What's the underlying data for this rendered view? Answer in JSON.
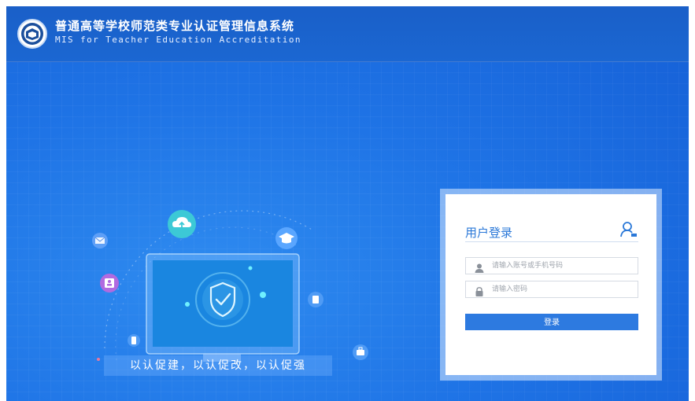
{
  "header": {
    "title_cn": "普通高等学校师范类专业认证管理信息系统",
    "title_en": "MIS for Teacher Education Accreditation"
  },
  "hero": {
    "slogan": "以认促建，以认促改，以认促强"
  },
  "login": {
    "title": "用户登录",
    "username_placeholder": "请输入账号或手机号码",
    "password_placeholder": "请输入密码",
    "submit_label": "登录"
  },
  "icons": {
    "logo": "university-seal-icon",
    "panel": "user-login-icon",
    "username": "user-icon",
    "password": "lock-icon",
    "cloud": "cloud-upload-icon",
    "graduation": "graduation-cap-icon",
    "shield": "shield-check-icon",
    "mail": "mail-icon",
    "id_card": "id-card-icon",
    "clipboard": "clipboard-icon",
    "phone": "phone-icon",
    "briefcase": "briefcase-icon",
    "monitor": "monitor-icon"
  },
  "colors": {
    "background": "#1f74e6",
    "topbar": "#1a5fc8",
    "accent": "#2d7ae0",
    "panel_title": "#2a78d8",
    "cloud_badge": "#3cc9d6",
    "id_badge": "#b06be0"
  }
}
